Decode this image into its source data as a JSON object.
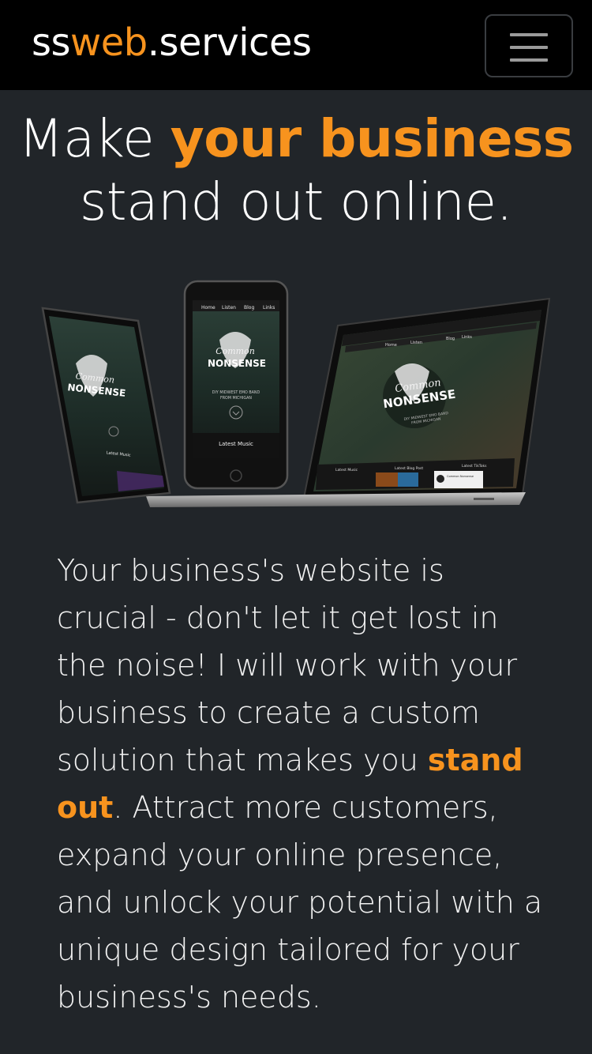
{
  "navbar": {
    "brand_prefix": "ss",
    "brand_accent": "web",
    "brand_suffix": ".services",
    "menu_icon": "hamburger-menu-icon"
  },
  "hero": {
    "line1_plain": "Make ",
    "line1_accent": "your business",
    "line2": "stand out online."
  },
  "mockup": {
    "tablet_brand_line1": "Common",
    "tablet_brand_line2": "NONSENSE",
    "tablet_latest": "Latest Music",
    "phone_nav": [
      "Home",
      "Listen",
      "Blog",
      "Links"
    ],
    "phone_brand_line1": "Common",
    "phone_brand_line2": "NONSENSE",
    "phone_tagline_1": "DIY MIDWEST EMO BAND",
    "phone_tagline_2": "FROM MICHIGAN",
    "phone_latest": "Latest Music",
    "laptop_nav": [
      "Home",
      "Listen",
      "Blog",
      "Links"
    ],
    "laptop_brand_line1": "Common",
    "laptop_brand_line2": "NONSENSE",
    "laptop_tagline_1": "DIY MIDWEST EMO BAND",
    "laptop_tagline_2": "FROM MICHIGAN",
    "laptop_section_1": "Latest Music",
    "laptop_section_2": "Latest Blog Post",
    "laptop_section_3": "Latest TikToks",
    "laptop_card_name": "Common Nonsense"
  },
  "body": {
    "text_before": "Your business's website is crucial - don't let it get lost in the noise! I will work with your business to create a custom solution that makes you ",
    "text_accent": "stand out",
    "text_after": ". Attract more customers, expand your online presence, and unlock your potential with a unique design tailored for your business's needs."
  },
  "colors": {
    "accent": "#f7931e",
    "background": "#212529",
    "navbar": "#000000"
  }
}
